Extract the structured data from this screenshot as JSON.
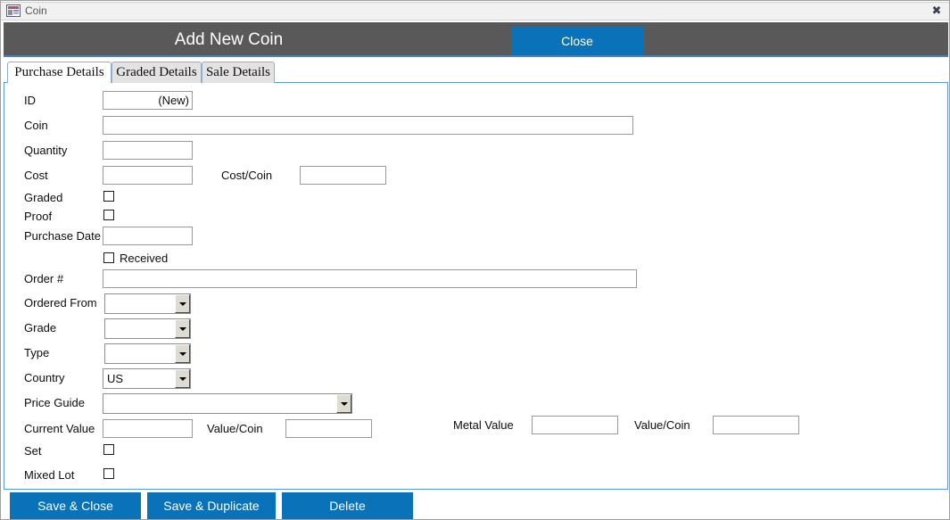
{
  "window": {
    "title": "Coin",
    "icon": "access-form-icon",
    "close_glyph": "✖"
  },
  "header": {
    "title": "Add New Coin",
    "close_label": "Close",
    "accent_color": "#0a72b9",
    "band_color": "#595959",
    "underline_color": "#4a81c4"
  },
  "tabs": [
    {
      "label": "Purchase Details",
      "active": true
    },
    {
      "label": "Graded Details",
      "active": false
    },
    {
      "label": "Sale Details",
      "active": false
    }
  ],
  "fields": {
    "id": {
      "label": "ID",
      "value": "(New)",
      "placeholder": ""
    },
    "coin": {
      "label": "Coin",
      "value": "",
      "placeholder": ""
    },
    "quantity": {
      "label": "Quantity",
      "value": "",
      "placeholder": ""
    },
    "cost": {
      "label": "Cost",
      "value": "",
      "placeholder": ""
    },
    "cost_per_coin": {
      "label": "Cost/Coin",
      "value": "",
      "placeholder": ""
    },
    "graded": {
      "label": "Graded",
      "checked": false
    },
    "proof": {
      "label": "Proof",
      "checked": false
    },
    "purchase_date": {
      "label": "Purchase Date",
      "value": "",
      "placeholder": ""
    },
    "received": {
      "label": "Received",
      "checked": false
    },
    "order_number": {
      "label": "Order #",
      "value": "",
      "placeholder": ""
    },
    "ordered_from": {
      "label": "Ordered From",
      "value": ""
    },
    "grade": {
      "label": "Grade",
      "value": ""
    },
    "type": {
      "label": "Type",
      "value": ""
    },
    "country": {
      "label": "Country",
      "value": "US"
    },
    "price_guide": {
      "label": "Price Guide",
      "value": ""
    },
    "current_value": {
      "label": "Current Value",
      "value": "",
      "placeholder": ""
    },
    "value_per_coin": {
      "label": "Value/Coin",
      "value": "",
      "placeholder": ""
    },
    "metal_value": {
      "label": "Metal Value",
      "value": "",
      "placeholder": ""
    },
    "metal_value_per_coin": {
      "label": "Value/Coin",
      "value": "",
      "placeholder": ""
    },
    "set": {
      "label": "Set",
      "checked": false
    },
    "mixed_lot": {
      "label": "Mixed Lot",
      "checked": false
    }
  },
  "actions": [
    {
      "label": "Save & Close"
    },
    {
      "label": "Save & Duplicate"
    },
    {
      "label": "Delete"
    }
  ]
}
